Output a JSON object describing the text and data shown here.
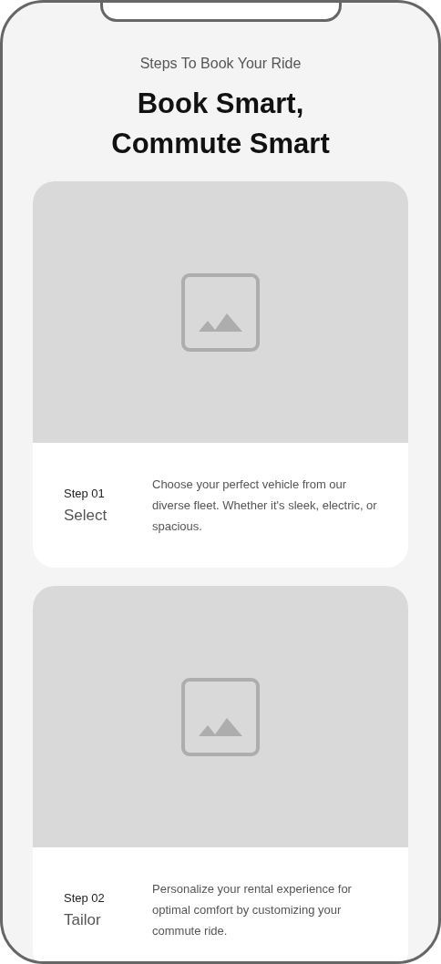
{
  "header": {
    "eyebrow": "Steps To Book Your Ride",
    "title": "Book Smart,\nCommute Smart"
  },
  "steps": [
    {
      "kind": "picture",
      "step": "Step 01",
      "name": "Select",
      "description": "Choose your perfect vehicle from our diverse fleet. Whether it's sleek, electric, or spacious."
    },
    {
      "kind": "picture",
      "step": "Step 02",
      "name": "Tailor",
      "description": "Personalize your rental experience for optimal comfort by customizing your commute ride."
    }
  ]
}
